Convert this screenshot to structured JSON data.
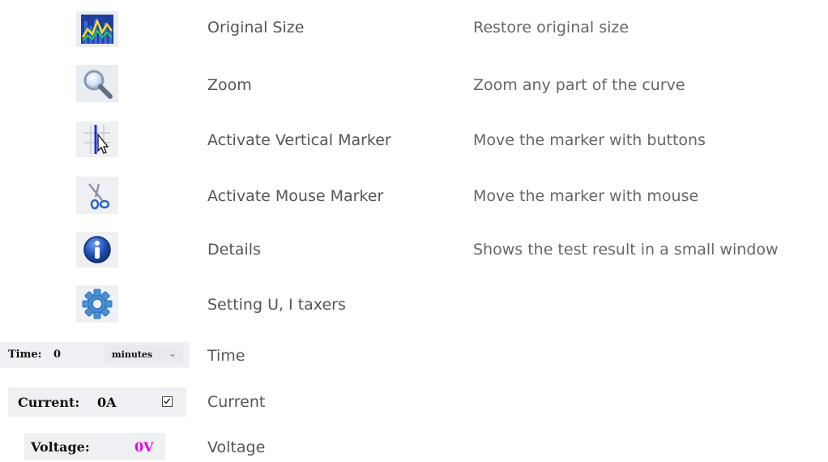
{
  "rows": [
    {
      "label": "Original Size",
      "description": "Restore original size",
      "icon": "chart-icon"
    },
    {
      "label": "Zoom",
      "description": "Zoom any part of the curve",
      "icon": "magnifier-icon"
    },
    {
      "label": "Activate Vertical Marker",
      "description": "Move the marker with buttons",
      "icon": "vertical-marker-icon"
    },
    {
      "label": "Activate Mouse Marker",
      "description": "Move the marker with mouse",
      "icon": "scissors-icon"
    },
    {
      "label": "Details",
      "description": "Shows the test result in a small window",
      "icon": "info-icon"
    },
    {
      "label": "Setting U, I taxers",
      "description": "",
      "icon": "gear-icon"
    },
    {
      "label": "Time",
      "description": ""
    },
    {
      "label": "Current",
      "description": ""
    },
    {
      "label": "Voltage",
      "description": ""
    }
  ],
  "controls": {
    "time": {
      "label": "Time:",
      "value": "0",
      "unit": "minutes"
    },
    "current": {
      "label": "Current:",
      "value": "0A",
      "checked": true
    },
    "voltage": {
      "label": "Voltage:",
      "value": "0V",
      "value_color": "#e600e6"
    }
  }
}
